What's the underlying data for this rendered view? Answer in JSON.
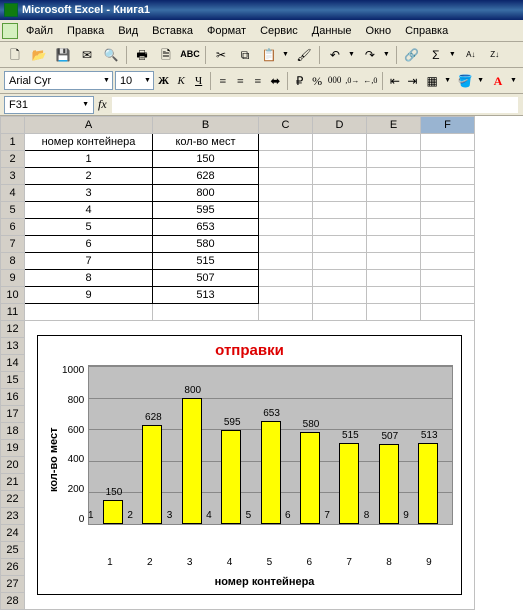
{
  "app": {
    "title": "Microsoft Excel - Книга1"
  },
  "menu": {
    "file": "Файл",
    "edit": "Правка",
    "view": "Вид",
    "insert": "Вставка",
    "format": "Формат",
    "tools": "Сервис",
    "data": "Данные",
    "window": "Окно",
    "help": "Справка"
  },
  "format_bar": {
    "font_name": "Arial Cyr",
    "font_size": "10"
  },
  "namebox": {
    "ref": "F31"
  },
  "columns": [
    "A",
    "B",
    "C",
    "D",
    "E",
    "F"
  ],
  "headers": {
    "A": "номер контейнера",
    "B": "кол-во мест"
  },
  "rows": [
    {
      "n": "1",
      "a": "1",
      "b": "150"
    },
    {
      "n": "2",
      "a": "2",
      "b": "628"
    },
    {
      "n": "3",
      "a": "3",
      "b": "800"
    },
    {
      "n": "4",
      "a": "4",
      "b": "595"
    },
    {
      "n": "5",
      "a": "5",
      "b": "653"
    },
    {
      "n": "6",
      "a": "6",
      "b": "580"
    },
    {
      "n": "7",
      "a": "7",
      "b": "515"
    },
    {
      "n": "8",
      "a": "8",
      "b": "507"
    },
    {
      "n": "9",
      "a": "9",
      "b": "513"
    }
  ],
  "empty_rows": [
    "11",
    "12",
    "13",
    "14",
    "15",
    "16",
    "17",
    "18",
    "19",
    "20",
    "21",
    "22",
    "23",
    "24",
    "25",
    "26",
    "27",
    "28"
  ],
  "chart_data": {
    "type": "bar",
    "title": "отправки",
    "xlabel": "номер контейнера",
    "ylabel": "кол-во мест",
    "categories": [
      "1",
      "2",
      "3",
      "4",
      "5",
      "6",
      "7",
      "8",
      "9"
    ],
    "values": [
      150,
      628,
      800,
      595,
      653,
      580,
      515,
      507,
      513
    ],
    "ylim": [
      0,
      1000
    ],
    "yticks": [
      0,
      200,
      400,
      600,
      800,
      1000
    ]
  }
}
